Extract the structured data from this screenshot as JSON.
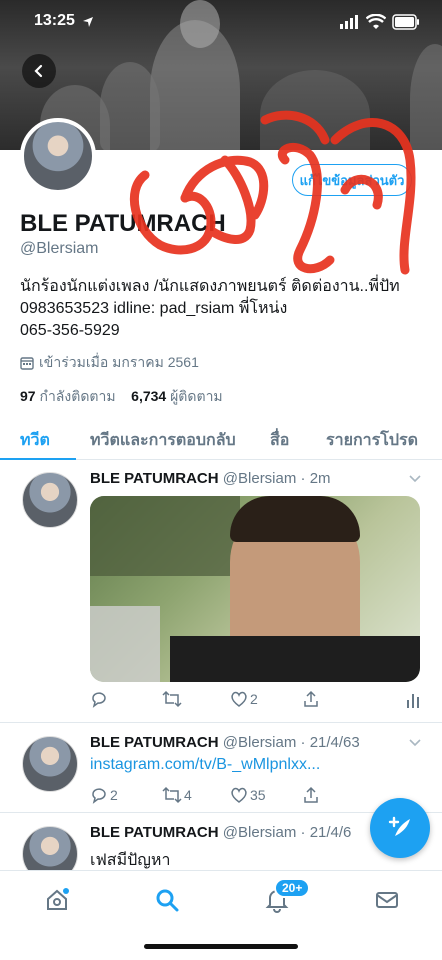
{
  "status_bar": {
    "time": "13:25",
    "location_icon": "location-arrow-icon",
    "signal_icon": "signal-icon",
    "wifi_icon": "wifi-icon",
    "battery_icon": "battery-icon"
  },
  "profile": {
    "name": "BLE PATUMRACH",
    "handle": "@Blersiam",
    "edit_button": "แก้ไขข้อมูลส่วนตัว",
    "bio": "นักร้องนักแต่งเพลง /นักแสดงภาพยนตร์ ติดต่องาน..พี่ปัท\n0983653523 idline: pad_rsiam พี่โหน่ง\n065-356-5929",
    "joined": "เข้าร่วมเมื่อ มกราคม 2561",
    "following_count": "97",
    "following_label": "กำลังติดตาม",
    "followers_count": "6,734",
    "followers_label": "ผู้ติดตาม"
  },
  "overlay": {
    "handwriting": "จริง",
    "color": "#e8331f"
  },
  "tabs": [
    {
      "label": "ทวีต",
      "active": true
    },
    {
      "label": "ทวีตและการตอบกลับ",
      "active": false
    },
    {
      "label": "สื่อ",
      "active": false
    },
    {
      "label": "รายการโปรด",
      "active": false
    }
  ],
  "tweets": [
    {
      "name": "BLE PATUMRACH",
      "handle": "@Blersiam",
      "time": "· 2m",
      "text": "",
      "likes": "2",
      "retweets": "",
      "replies": ""
    },
    {
      "name": "BLE PATUMRACH",
      "handle": "@Blersiam",
      "time": "· 21/4/63",
      "text": "instagram.com/tv/B-_wMlpnlxx...",
      "replies": "2",
      "retweets": "4",
      "likes": "35"
    },
    {
      "name": "BLE PATUMRACH",
      "handle": "@Blersiam",
      "time": "· 21/4/6",
      "text": "เฟสมีปัญหา"
    }
  ],
  "bottom_nav": {
    "notifications_badge": "20+"
  },
  "colors": {
    "accent": "#1da1f2",
    "text": "#14171a",
    "muted": "#657786"
  }
}
